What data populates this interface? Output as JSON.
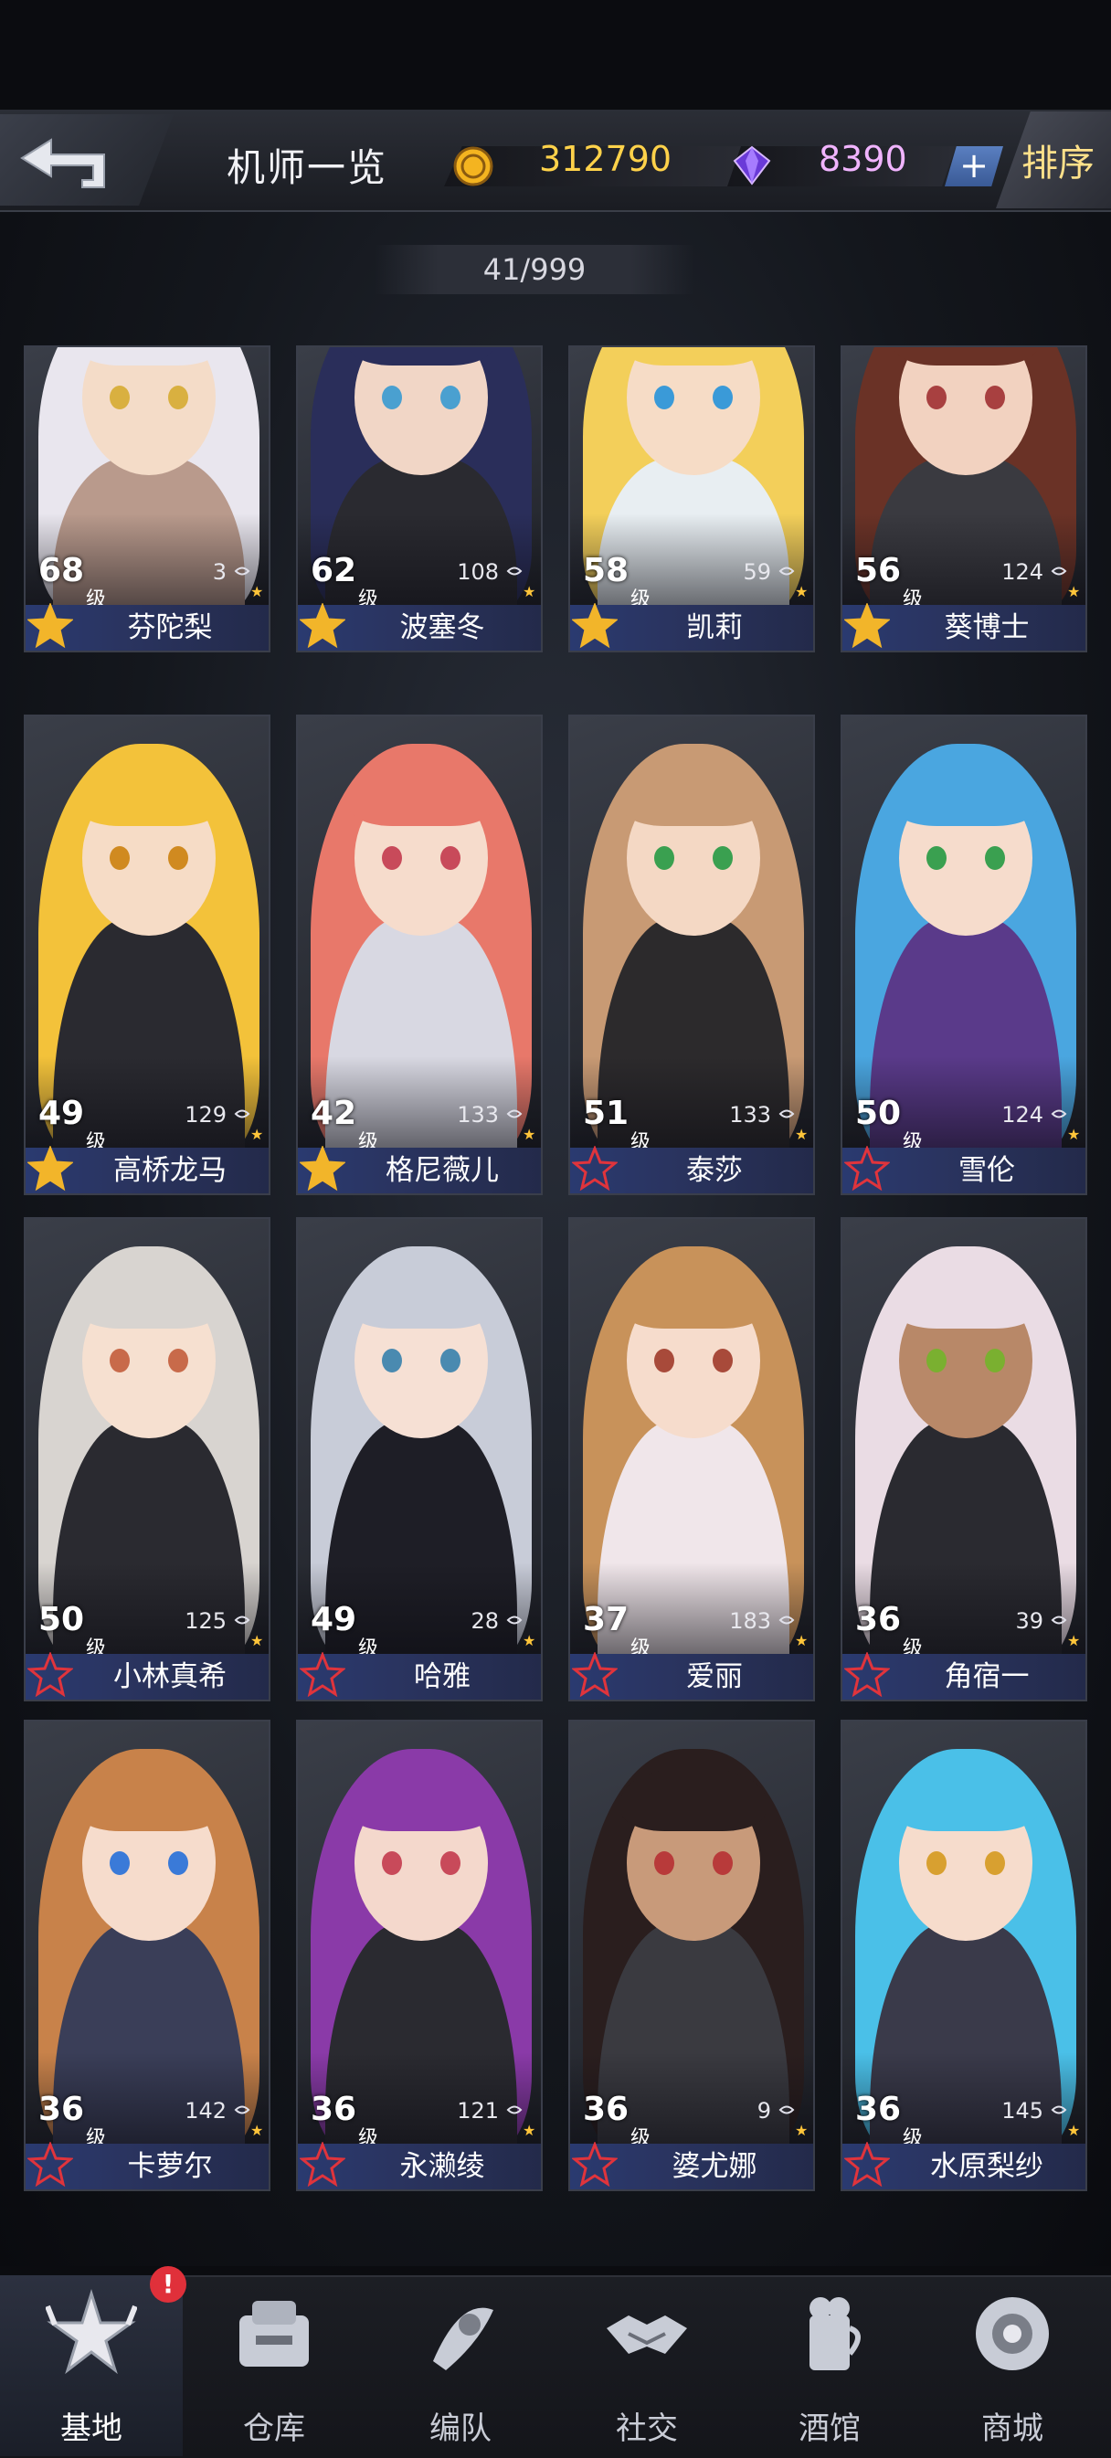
{
  "header": {
    "title": "机师一览",
    "coins": "312790",
    "gems": "8390",
    "plus_label": "+",
    "sort_label": "排序",
    "icons": {
      "back": "back-arrow-icon",
      "coin": "coin-icon",
      "gem": "gem-icon"
    }
  },
  "roster_count": "41/999",
  "level_unit": "级",
  "pilots": [
    {
      "level": "68",
      "count": "3",
      "name": "芬陀梨",
      "rank": "gold",
      "hair": "#e9e6ee",
      "skin": "#f4dcc8",
      "outfit": "#b99a8c",
      "eyes": "#d9b040"
    },
    {
      "level": "62",
      "count": "108",
      "name": "波塞冬",
      "rank": "gold",
      "hair": "#2a2e5a",
      "skin": "#f1d6c6",
      "outfit": "#2a2a30",
      "eyes": "#4aa0d0"
    },
    {
      "level": "58",
      "count": "59",
      "name": "凯莉",
      "rank": "gold",
      "hair": "#f3cf5a",
      "skin": "#f6dcc6",
      "outfit": "#e8eef2",
      "eyes": "#3a9ad8"
    },
    {
      "level": "56",
      "count": "124",
      "name": "葵博士",
      "rank": "gold",
      "hair": "#6a3226",
      "skin": "#f2d2c0",
      "outfit": "#3a3a40",
      "eyes": "#a84040"
    },
    {
      "level": "49",
      "count": "129",
      "name": "高桥龙马",
      "rank": "gold",
      "hair": "#f3c23a",
      "skin": "#f6dcc6",
      "outfit": "#2a2a30",
      "eyes": "#d08a20"
    },
    {
      "level": "42",
      "count": "133",
      "name": "格尼薇儿",
      "rank": "gold",
      "hair": "#e8786a",
      "skin": "#f6dccc",
      "outfit": "#d8d8e2",
      "eyes": "#c84a5a"
    },
    {
      "level": "51",
      "count": "133",
      "name": "泰莎",
      "rank": "red",
      "hair": "#c89a74",
      "skin": "#f4d8c4",
      "outfit": "#2c2a2c",
      "eyes": "#3aa050"
    },
    {
      "level": "50",
      "count": "124",
      "name": "雪伦",
      "rank": "red",
      "hair": "#4aa6e0",
      "skin": "#f6dccc",
      "outfit": "#5a3a8a",
      "eyes": "#3aa050"
    },
    {
      "level": "50",
      "count": "125",
      "name": "小林真希",
      "rank": "red",
      "hair": "#d8d4d0",
      "skin": "#f6e0d0",
      "outfit": "#2a2a30",
      "eyes": "#c86a4a"
    },
    {
      "level": "49",
      "count": "28",
      "name": "哈雅",
      "rank": "red",
      "hair": "#c8ccd8",
      "skin": "#f6e0d4",
      "outfit": "#1e1e26",
      "eyes": "#4a8ab0"
    },
    {
      "level": "37",
      "count": "183",
      "name": "爱丽",
      "rank": "red",
      "hair": "#c8925a",
      "skin": "#f6dccc",
      "outfit": "#f0e6ea",
      "eyes": "#a84a3a"
    },
    {
      "level": "36",
      "count": "39",
      "name": "角宿一",
      "rank": "red",
      "hair": "#eadce4",
      "skin": "#b88868",
      "outfit": "#2a2a30",
      "eyes": "#7ab030"
    },
    {
      "level": "36",
      "count": "142",
      "name": "卡萝尔",
      "rank": "red",
      "hair": "#c8824a",
      "skin": "#f6dccc",
      "outfit": "#3a3e58",
      "eyes": "#3a7ad8"
    },
    {
      "level": "36",
      "count": "121",
      "name": "永濑绫",
      "rank": "red",
      "hair": "#8a3aa8",
      "skin": "#f4d8cc",
      "outfit": "#2a2a30",
      "eyes": "#c84a5a"
    },
    {
      "level": "36",
      "count": "9",
      "name": "婆尤娜",
      "rank": "red",
      "hair": "#2a1e1e",
      "skin": "#c89a7a",
      "outfit": "#3a3a40",
      "eyes": "#b83a3a"
    },
    {
      "level": "36",
      "count": "145",
      "name": "水原梨纱",
      "rank": "red",
      "hair": "#4ac0e8",
      "skin": "#f6dccc",
      "outfit": "#3a3a4a",
      "eyes": "#d8a030"
    }
  ],
  "nav": [
    {
      "label": "基地",
      "icon": "base-icon",
      "active": true
    },
    {
      "label": "仓库",
      "icon": "warehouse-icon",
      "active": false
    },
    {
      "label": "编队",
      "icon": "formation-icon",
      "active": false
    },
    {
      "label": "社交",
      "icon": "handshake-icon",
      "active": false
    },
    {
      "label": "酒馆",
      "icon": "tavern-icon",
      "active": false
    },
    {
      "label": "商城",
      "icon": "shop-icon",
      "active": false
    }
  ],
  "nav_alert": "!",
  "colors": {
    "gold_coin": "#ffd24a",
    "gem": "#f1b4ff",
    "name_bar": "#2a3a70",
    "rank_gold": "#f2b52a",
    "rank_red": "#e0343c",
    "alert": "#e0303a"
  }
}
